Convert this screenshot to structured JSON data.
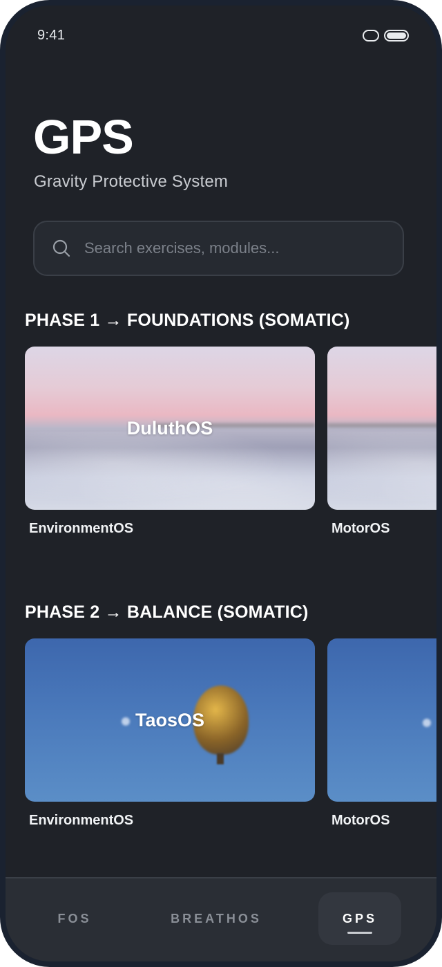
{
  "status_bar": {
    "time": "9:41"
  },
  "header": {
    "title": "GPS",
    "subtitle": "Gravity Protective System"
  },
  "search": {
    "placeholder": "Search exercises, modules..."
  },
  "phases": [
    {
      "title": "PHASE 1 → FOUNDATIONS (SOMATIC)",
      "cards": [
        {
          "image_label": "DuluthOS",
          "caption": "EnvironmentOS"
        },
        {
          "image_label": "",
          "caption": "MotorOS"
        }
      ]
    },
    {
      "title": "PHASE 2 → BALANCE (SOMATIC)",
      "cards": [
        {
          "image_label": "TaosOS",
          "caption": "EnvironmentOS"
        },
        {
          "image_label": "",
          "caption": "MotorOS"
        }
      ]
    }
  ],
  "tab_bar": {
    "tabs": [
      {
        "label": "FOS",
        "active": false
      },
      {
        "label": "BREATHOS",
        "active": false
      },
      {
        "label": "GPS",
        "active": true
      }
    ]
  },
  "icons": [
    "search-icon",
    "cellular-icon",
    "battery-icon"
  ]
}
